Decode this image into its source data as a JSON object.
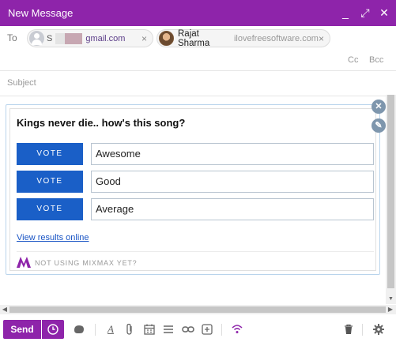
{
  "window": {
    "title": "New Message",
    "controls": {
      "minimize": "_",
      "maximize": "⤢",
      "close": "✕"
    }
  },
  "recipients": {
    "to_label": "To",
    "chips": [
      {
        "prefix": "S",
        "email": "gmail.com",
        "remove": "×",
        "icon": "person-icon"
      },
      {
        "name": "Rajat Sharma",
        "email": "ilovefreesoftware.com",
        "remove": "×",
        "icon": "avatar-photo"
      }
    ],
    "cc": "Cc",
    "bcc": "Bcc"
  },
  "subject": {
    "placeholder": "Subject"
  },
  "poll": {
    "question": "Kings never die.. how's this song?",
    "vote_label": "VOTE",
    "options": [
      "Awesome",
      "Good",
      "Average"
    ],
    "results_link": "View results online",
    "footer": "NOT USING MIXMAX YET?",
    "side_icons": [
      "close-icon",
      "edit-pencil-icon"
    ]
  },
  "toolbar": {
    "send_label": "Send",
    "icons": [
      "schedule-clock-icon",
      "templates-icon",
      "format-text-icon",
      "attach-icon",
      "calendar-icon",
      "list-icon",
      "link-icon",
      "insert-icon",
      "tracking-icon",
      "trash-icon",
      "settings-icon"
    ]
  },
  "colors": {
    "brand": "#8e24aa",
    "vote_button": "#1a5fc7",
    "link": "#1a55c5"
  }
}
